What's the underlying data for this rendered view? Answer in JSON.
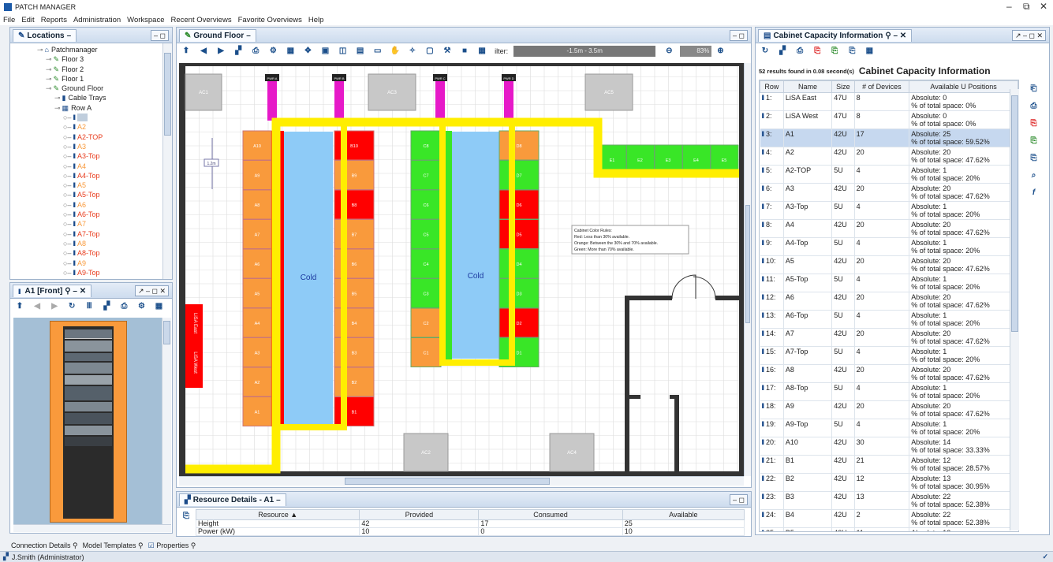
{
  "app": {
    "title": "PATCH MANAGER"
  },
  "menu": [
    "File",
    "Edit",
    "Reports",
    "Administration",
    "Workspace",
    "Recent Overviews",
    "Favorite Overviews",
    "Help"
  ],
  "locations": {
    "tab": "Locations",
    "items": [
      {
        "label": "Patchmanager",
        "indent": 0,
        "type": "root"
      },
      {
        "label": "Floor 3",
        "indent": 1,
        "type": "floor"
      },
      {
        "label": "Floor 2",
        "indent": 1,
        "type": "floor"
      },
      {
        "label": "Floor 1",
        "indent": 1,
        "type": "floor"
      },
      {
        "label": "Ground Floor",
        "indent": 1,
        "type": "floor"
      },
      {
        "label": "Cable Trays",
        "indent": 2,
        "type": "tray"
      },
      {
        "label": "Row A",
        "indent": 2,
        "type": "row"
      },
      {
        "label": "A1",
        "indent": 3,
        "type": "rack",
        "color": "sel"
      },
      {
        "label": "A2",
        "indent": 3,
        "type": "rack",
        "color": "orange"
      },
      {
        "label": "A2-TOP",
        "indent": 3,
        "type": "rack",
        "color": "red"
      },
      {
        "label": "A3",
        "indent": 3,
        "type": "rack",
        "color": "orange"
      },
      {
        "label": "A3-Top",
        "indent": 3,
        "type": "rack",
        "color": "red"
      },
      {
        "label": "A4",
        "indent": 3,
        "type": "rack",
        "color": "orange"
      },
      {
        "label": "A4-Top",
        "indent": 3,
        "type": "rack",
        "color": "red"
      },
      {
        "label": "A5",
        "indent": 3,
        "type": "rack",
        "color": "orange"
      },
      {
        "label": "A5-Top",
        "indent": 3,
        "type": "rack",
        "color": "red"
      },
      {
        "label": "A6",
        "indent": 3,
        "type": "rack",
        "color": "orange"
      },
      {
        "label": "A6-Top",
        "indent": 3,
        "type": "rack",
        "color": "red"
      },
      {
        "label": "A7",
        "indent": 3,
        "type": "rack",
        "color": "orange"
      },
      {
        "label": "A7-Top",
        "indent": 3,
        "type": "rack",
        "color": "red"
      },
      {
        "label": "A8",
        "indent": 3,
        "type": "rack",
        "color": "orange"
      },
      {
        "label": "A8-Top",
        "indent": 3,
        "type": "rack",
        "color": "red"
      },
      {
        "label": "A9",
        "indent": 3,
        "type": "rack",
        "color": "orange"
      },
      {
        "label": "A9-Top",
        "indent": 3,
        "type": "rack",
        "color": "red"
      }
    ]
  },
  "rackview": {
    "tab": "A1 [Front]"
  },
  "floor": {
    "tab": "Ground Floor",
    "filter_label": "ilter:",
    "filter_value": "-1.5m - 3.5m",
    "zoom": "83%",
    "measure": "1.2m",
    "cold_label": "Cold",
    "pdu": [
      "PWR A",
      "PWR B",
      "PWR C",
      "PWR D"
    ],
    "ac": [
      "AC1",
      "AC3",
      "AC5",
      "AC2",
      "AC4"
    ],
    "rowA": [
      "A10",
      "A9",
      "A8",
      "A7",
      "A6",
      "A5",
      "A4",
      "A3",
      "A2",
      "A1"
    ],
    "rowB": [
      "B10",
      "B9",
      "B8",
      "B7",
      "B6",
      "B5",
      "B4",
      "B3",
      "B2",
      "B1"
    ],
    "rowB_colors": [
      "red",
      "orange",
      "red",
      "orange",
      "orange",
      "orange",
      "orange",
      "orange",
      "orange",
      "red"
    ],
    "rowC": [
      "C8",
      "C7",
      "C6",
      "C5",
      "C4",
      "C3",
      "C2",
      "C1"
    ],
    "rowC_colors": [
      "green",
      "green",
      "green",
      "green",
      "green",
      "green",
      "orange",
      "orange"
    ],
    "rowD": [
      "D8",
      "D7",
      "D6",
      "D5",
      "D4",
      "D3",
      "D2",
      "D1"
    ],
    "rowD_colors": [
      "orange",
      "green",
      "red",
      "red",
      "green",
      "green",
      "red",
      "green"
    ],
    "rowE": [
      "E1",
      "E2",
      "E3",
      "E4",
      "E5"
    ],
    "lisa": [
      "LiSA East",
      "LiSA West"
    ],
    "legend": [
      "Cabinet Color Rules:",
      "Red: Less than 30% available.",
      "Orange: Between the 30% and 70% available.",
      "Green: More than 70% available."
    ],
    "colors": {
      "red": "#ff0000",
      "orange": "#f99a3c",
      "green": "#39e627",
      "cold": "#8ecbf7",
      "tray": "#ffee00",
      "pdu": "#e619c8"
    }
  },
  "resource": {
    "tab": "Resource Details - A1",
    "headers": [
      "Resource ▲",
      "Provided",
      "Consumed",
      "Available"
    ],
    "rows": [
      [
        "Height",
        "42",
        "17",
        "25"
      ],
      [
        "Power (kW)",
        "10",
        "0",
        "10"
      ]
    ]
  },
  "capacity": {
    "tab": "Cabinet Capacity Information",
    "summary": "52 results found in 0.08 second(s)",
    "heading": "Cabinet Capacity Information",
    "headers": [
      "Row",
      "Name",
      "Size",
      "# of Devices",
      "Available U Positions"
    ],
    "rows": [
      [
        "1:",
        "LiSA East",
        "47U",
        "8",
        "Absolute: 0",
        "% of total space: 0%"
      ],
      [
        "2:",
        "LiSA West",
        "47U",
        "8",
        "Absolute: 0",
        "% of total space: 0%"
      ],
      [
        "3:",
        "A1",
        "42U",
        "17",
        "Absolute: 25",
        "% of total space: 59.52%"
      ],
      [
        "4:",
        "A2",
        "42U",
        "20",
        "Absolute: 20",
        "% of total space: 47.62%"
      ],
      [
        "5:",
        "A2-TOP",
        "5U",
        "4",
        "Absolute: 1",
        "% of total space: 20%"
      ],
      [
        "6:",
        "A3",
        "42U",
        "20",
        "Absolute: 20",
        "% of total space: 47.62%"
      ],
      [
        "7:",
        "A3-Top",
        "5U",
        "4",
        "Absolute: 1",
        "% of total space: 20%"
      ],
      [
        "8:",
        "A4",
        "42U",
        "20",
        "Absolute: 20",
        "% of total space: 47.62%"
      ],
      [
        "9:",
        "A4-Top",
        "5U",
        "4",
        "Absolute: 1",
        "% of total space: 20%"
      ],
      [
        "10:",
        "A5",
        "42U",
        "20",
        "Absolute: 20",
        "% of total space: 47.62%"
      ],
      [
        "11:",
        "A5-Top",
        "5U",
        "4",
        "Absolute: 1",
        "% of total space: 20%"
      ],
      [
        "12:",
        "A6",
        "42U",
        "20",
        "Absolute: 20",
        "% of total space: 47.62%"
      ],
      [
        "13:",
        "A6-Top",
        "5U",
        "4",
        "Absolute: 1",
        "% of total space: 20%"
      ],
      [
        "14:",
        "A7",
        "42U",
        "20",
        "Absolute: 20",
        "% of total space: 47.62%"
      ],
      [
        "15:",
        "A7-Top",
        "5U",
        "4",
        "Absolute: 1",
        "% of total space: 20%"
      ],
      [
        "16:",
        "A8",
        "42U",
        "20",
        "Absolute: 20",
        "% of total space: 47.62%"
      ],
      [
        "17:",
        "A8-Top",
        "5U",
        "4",
        "Absolute: 1",
        "% of total space: 20%"
      ],
      [
        "18:",
        "A9",
        "42U",
        "20",
        "Absolute: 20",
        "% of total space: 47.62%"
      ],
      [
        "19:",
        "A9-Top",
        "5U",
        "4",
        "Absolute: 1",
        "% of total space: 20%"
      ],
      [
        "20:",
        "A10",
        "42U",
        "30",
        "Absolute: 14",
        "% of total space: 33.33%"
      ],
      [
        "21:",
        "B1",
        "42U",
        "21",
        "Absolute: 12",
        "% of total space: 28.57%"
      ],
      [
        "22:",
        "B2",
        "42U",
        "12",
        "Absolute: 13",
        "% of total space: 30.95%"
      ],
      [
        "23:",
        "B3",
        "42U",
        "13",
        "Absolute: 22",
        "% of total space: 52.38%"
      ],
      [
        "24:",
        "B4",
        "42U",
        "2",
        "Absolute: 22",
        "% of total space: 52.38%"
      ],
      [
        "25:",
        "B5",
        "42U",
        "11",
        "Absolute: 13",
        ""
      ]
    ]
  },
  "bottom_tabs": [
    "Connection Details",
    "Model Templates",
    "Properties"
  ],
  "status": {
    "user": "J.Smith (Administrator)"
  }
}
